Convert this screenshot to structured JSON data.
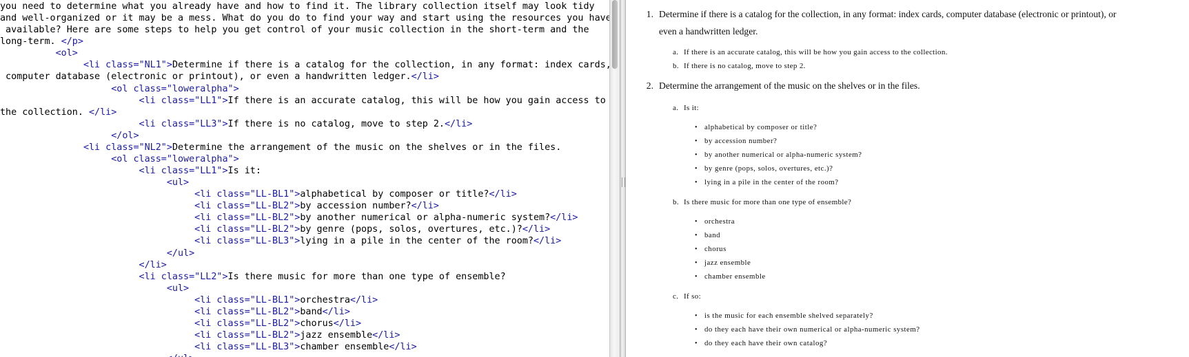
{
  "source_view": {
    "lines": [
      [
        {
          "t": "txt",
          "v": "you need to determine what you already have and how to find it. The library collection itself may look tidy"
        }
      ],
      [
        {
          "t": "txt",
          "v": "and well-organized or it may be a mess. What do you do to find your way and start using the resources you have"
        }
      ],
      [
        {
          "t": "txt",
          "v": " available? Here are some steps to help you get control of your music collection in the short-term and the"
        }
      ],
      [
        {
          "t": "txt",
          "v": "long-term. "
        },
        {
          "t": "tag",
          "v": "</p>"
        }
      ],
      [
        {
          "t": "txt",
          "v": "          "
        },
        {
          "t": "tag",
          "v": "<ol>"
        }
      ],
      [
        {
          "t": "txt",
          "v": "               "
        },
        {
          "t": "tag",
          "v": "<li class="
        },
        {
          "t": "str",
          "v": "\"NL1\""
        },
        {
          "t": "tag",
          "v": ">"
        },
        {
          "t": "txt",
          "v": "Determine if there is a catalog for the collection, in any format: index cards,"
        }
      ],
      [
        {
          "t": "txt",
          "v": " computer database (electronic or printout), or even a handwritten ledger."
        },
        {
          "t": "tag",
          "v": "</li>"
        }
      ],
      [
        {
          "t": "txt",
          "v": "                    "
        },
        {
          "t": "tag",
          "v": "<ol class="
        },
        {
          "t": "str",
          "v": "\"loweralpha\""
        },
        {
          "t": "tag",
          "v": ">"
        }
      ],
      [
        {
          "t": "txt",
          "v": "                         "
        },
        {
          "t": "tag",
          "v": "<li class="
        },
        {
          "t": "str",
          "v": "\"LL1\""
        },
        {
          "t": "tag",
          "v": ">"
        },
        {
          "t": "txt",
          "v": "If there is an accurate catalog, this will be how you gain access to"
        }
      ],
      [
        {
          "t": "txt",
          "v": "the collection. "
        },
        {
          "t": "tag",
          "v": "</li>"
        }
      ],
      [
        {
          "t": "txt",
          "v": "                         "
        },
        {
          "t": "tag",
          "v": "<li class="
        },
        {
          "t": "str",
          "v": "\"LL3\""
        },
        {
          "t": "tag",
          "v": ">"
        },
        {
          "t": "txt",
          "v": "If there is no catalog, move to step 2."
        },
        {
          "t": "tag",
          "v": "</li>"
        }
      ],
      [
        {
          "t": "txt",
          "v": "                    "
        },
        {
          "t": "tag",
          "v": "</ol>"
        }
      ],
      [
        {
          "t": "txt",
          "v": "               "
        },
        {
          "t": "tag",
          "v": "<li class="
        },
        {
          "t": "str",
          "v": "\"NL2\""
        },
        {
          "t": "tag",
          "v": ">"
        },
        {
          "t": "txt",
          "v": "Determine the arrangement of the music on the shelves or in the files."
        }
      ],
      [
        {
          "t": "txt",
          "v": "                    "
        },
        {
          "t": "tag",
          "v": "<ol class="
        },
        {
          "t": "str",
          "v": "\"loweralpha\""
        },
        {
          "t": "tag",
          "v": ">"
        }
      ],
      [
        {
          "t": "txt",
          "v": "                         "
        },
        {
          "t": "tag",
          "v": "<li class="
        },
        {
          "t": "str",
          "v": "\"LL1\""
        },
        {
          "t": "tag",
          "v": ">"
        },
        {
          "t": "txt",
          "v": "Is it:"
        }
      ],
      [
        {
          "t": "txt",
          "v": "                              "
        },
        {
          "t": "tag",
          "v": "<ul>"
        }
      ],
      [
        {
          "t": "txt",
          "v": "                                   "
        },
        {
          "t": "tag",
          "v": "<li class="
        },
        {
          "t": "str",
          "v": "\"LL-BL1\""
        },
        {
          "t": "tag",
          "v": ">"
        },
        {
          "t": "txt",
          "v": "alphabetical by composer or title?"
        },
        {
          "t": "tag",
          "v": "</li>"
        }
      ],
      [
        {
          "t": "txt",
          "v": "                                   "
        },
        {
          "t": "tag",
          "v": "<li class="
        },
        {
          "t": "str",
          "v": "\"LL-BL2\""
        },
        {
          "t": "tag",
          "v": ">"
        },
        {
          "t": "txt",
          "v": "by accession number?"
        },
        {
          "t": "tag",
          "v": "</li>"
        }
      ],
      [
        {
          "t": "txt",
          "v": "                                   "
        },
        {
          "t": "tag",
          "v": "<li class="
        },
        {
          "t": "str",
          "v": "\"LL-BL2\""
        },
        {
          "t": "tag",
          "v": ">"
        },
        {
          "t": "txt",
          "v": "by another numerical or alpha-numeric system?"
        },
        {
          "t": "tag",
          "v": "</li>"
        }
      ],
      [
        {
          "t": "txt",
          "v": "                                   "
        },
        {
          "t": "tag",
          "v": "<li class="
        },
        {
          "t": "str",
          "v": "\"LL-BL2\""
        },
        {
          "t": "tag",
          "v": ">"
        },
        {
          "t": "txt",
          "v": "by genre (pops, solos, overtures, etc.)?"
        },
        {
          "t": "tag",
          "v": "</li>"
        }
      ],
      [
        {
          "t": "txt",
          "v": "                                   "
        },
        {
          "t": "tag",
          "v": "<li class="
        },
        {
          "t": "str",
          "v": "\"LL-BL3\""
        },
        {
          "t": "tag",
          "v": ">"
        },
        {
          "t": "txt",
          "v": "lying in a pile in the center of the room?"
        },
        {
          "t": "tag",
          "v": "</li>"
        }
      ],
      [
        {
          "t": "txt",
          "v": "                              "
        },
        {
          "t": "tag",
          "v": "</ul>"
        }
      ],
      [
        {
          "t": "txt",
          "v": "                         "
        },
        {
          "t": "tag",
          "v": "</li>"
        }
      ],
      [
        {
          "t": "txt",
          "v": "                         "
        },
        {
          "t": "tag",
          "v": "<li class="
        },
        {
          "t": "str",
          "v": "\"LL2\""
        },
        {
          "t": "tag",
          "v": ">"
        },
        {
          "t": "txt",
          "v": "Is there music for more than one type of ensemble?"
        }
      ],
      [
        {
          "t": "txt",
          "v": "                              "
        },
        {
          "t": "tag",
          "v": "<ul>"
        }
      ],
      [
        {
          "t": "txt",
          "v": "                                   "
        },
        {
          "t": "tag",
          "v": "<li class="
        },
        {
          "t": "str",
          "v": "\"LL-BL1\""
        },
        {
          "t": "tag",
          "v": ">"
        },
        {
          "t": "txt",
          "v": "orchestra"
        },
        {
          "t": "tag",
          "v": "</li>"
        }
      ],
      [
        {
          "t": "txt",
          "v": "                                   "
        },
        {
          "t": "tag",
          "v": "<li class="
        },
        {
          "t": "str",
          "v": "\"LL-BL2\""
        },
        {
          "t": "tag",
          "v": ">"
        },
        {
          "t": "txt",
          "v": "band"
        },
        {
          "t": "tag",
          "v": "</li>"
        }
      ],
      [
        {
          "t": "txt",
          "v": "                                   "
        },
        {
          "t": "tag",
          "v": "<li class="
        },
        {
          "t": "str",
          "v": "\"LL-BL2\""
        },
        {
          "t": "tag",
          "v": ">"
        },
        {
          "t": "txt",
          "v": "chorus"
        },
        {
          "t": "tag",
          "v": "</li>"
        }
      ],
      [
        {
          "t": "txt",
          "v": "                                   "
        },
        {
          "t": "tag",
          "v": "<li class="
        },
        {
          "t": "str",
          "v": "\"LL-BL2\""
        },
        {
          "t": "tag",
          "v": ">"
        },
        {
          "t": "txt",
          "v": "jazz ensemble"
        },
        {
          "t": "tag",
          "v": "</li>"
        }
      ],
      [
        {
          "t": "txt",
          "v": "                                   "
        },
        {
          "t": "tag",
          "v": "<li class="
        },
        {
          "t": "str",
          "v": "\"LL-BL3\""
        },
        {
          "t": "tag",
          "v": ">"
        },
        {
          "t": "txt",
          "v": "chamber ensemble"
        },
        {
          "t": "tag",
          "v": "</li>"
        }
      ],
      [
        {
          "t": "txt",
          "v": "                              "
        },
        {
          "t": "tag",
          "v": "</ul>"
        }
      ]
    ]
  },
  "preview": {
    "item1": {
      "number": "1.",
      "text_line1": "Determine if there is a catalog for the collection, in any format: index cards, computer database (electronic or printout), or",
      "text_line2": "even a handwritten ledger.",
      "subitems": [
        {
          "marker": "a.",
          "text": "If there is an accurate catalog, this will be how you gain access to the collection."
        },
        {
          "marker": "b.",
          "text": "If there is no catalog, move to step 2."
        }
      ]
    },
    "item2": {
      "number": "2.",
      "text": "Determine the arrangement of the music on the shelves or in the files.",
      "sub_a": {
        "marker": "a.",
        "text": "Is it:",
        "bullets": [
          "alphabetical by composer or title?",
          "by accession number?",
          "by another numerical or alpha-numeric system?",
          "by genre (pops, solos, overtures, etc.)?",
          "lying in a pile in the center of the room?"
        ]
      },
      "sub_b": {
        "marker": "b.",
        "text": "Is there music for more than one type of ensemble?",
        "bullets": [
          "orchestra",
          "band",
          "chorus",
          "jazz ensemble",
          "chamber ensemble"
        ]
      },
      "sub_c": {
        "marker": "c.",
        "text": "If so:",
        "bullets": [
          "is the music for each ensemble shelved separately?",
          "do they each have their own numerical or alpha-numeric system?",
          "do they each have their own catalog?"
        ]
      }
    }
  }
}
